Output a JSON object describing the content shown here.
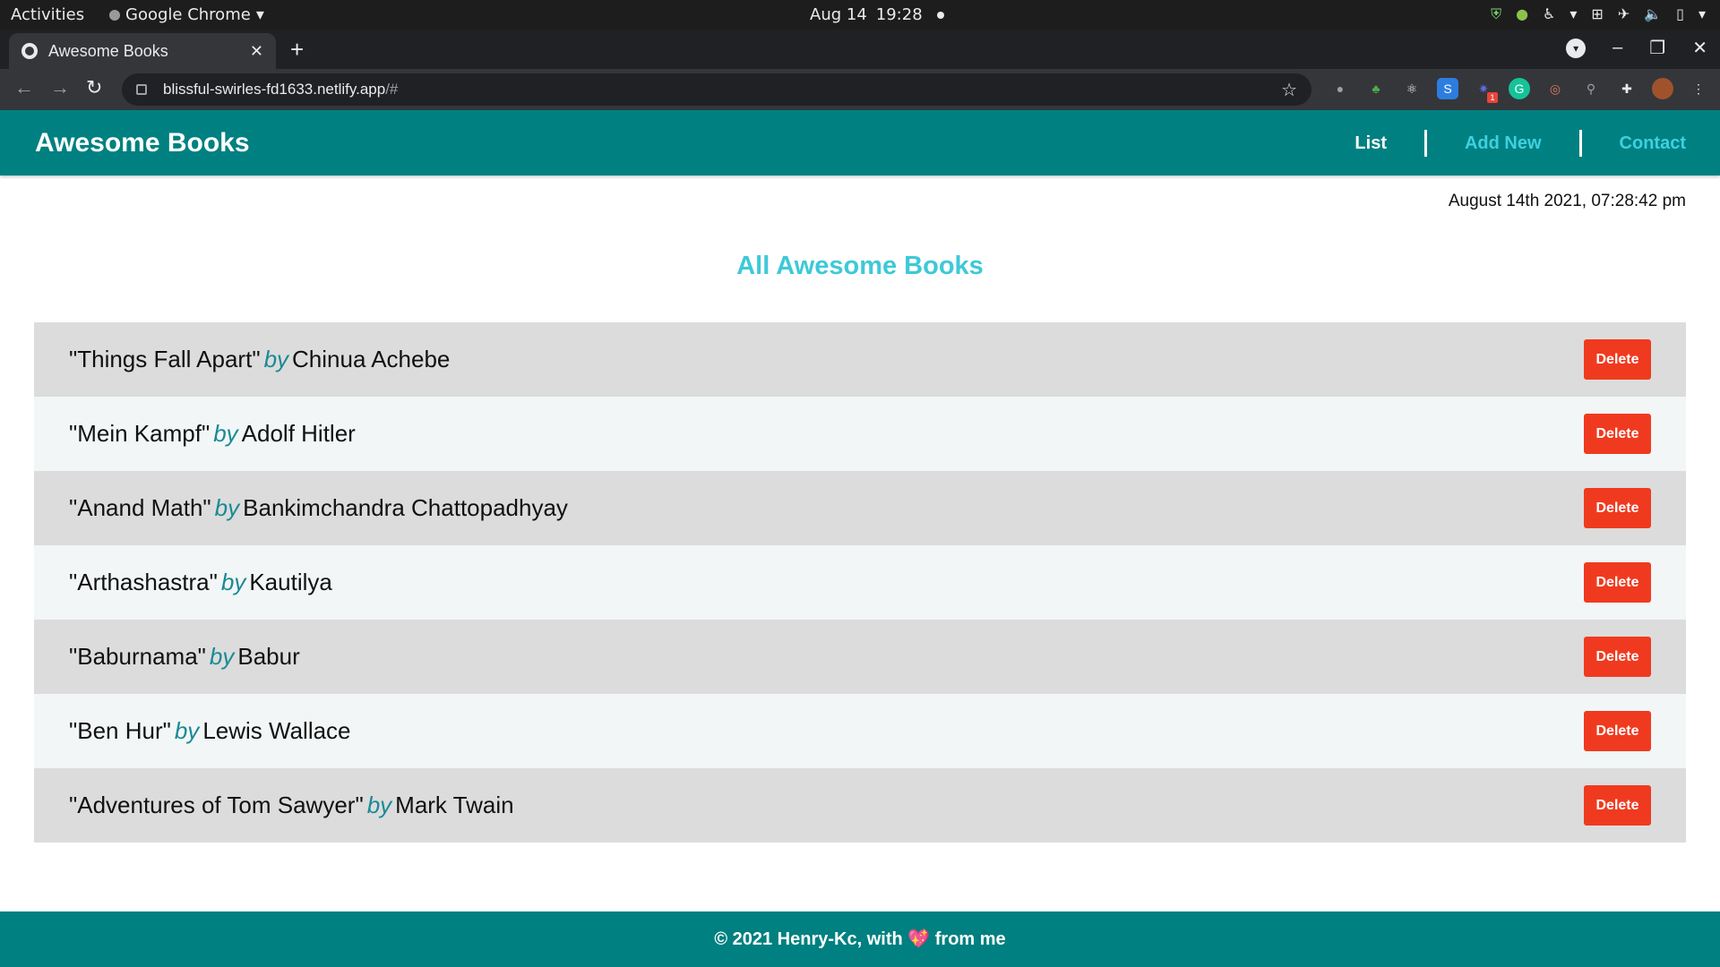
{
  "system_bar": {
    "activities": "Activities",
    "app_name": "Google Chrome",
    "date": "Aug 14",
    "time": "19:28"
  },
  "browser": {
    "tab_title": "Awesome Books",
    "url_host": "blissful-swirles-fd1633.netlify.app",
    "url_path": "/#"
  },
  "header": {
    "brand": "Awesome Books",
    "nav": {
      "list": "List",
      "add_new": "Add New",
      "contact": "Contact"
    }
  },
  "datetime": "August 14th 2021, 07:28:42 pm",
  "page_title": "All Awesome Books",
  "by_label": "by",
  "delete_label": "Delete",
  "books": [
    {
      "title": "\"Things Fall Apart\"",
      "author": "Chinua Achebe"
    },
    {
      "title": "\"Mein Kampf\"",
      "author": "Adolf Hitler"
    },
    {
      "title": "\"Anand Math\"",
      "author": "Bankimchandra Chattopadhyay"
    },
    {
      "title": "\"Arthashastra\"",
      "author": "Kautilya"
    },
    {
      "title": "\"Baburnama\"",
      "author": "Babur"
    },
    {
      "title": "\"Ben Hur\"",
      "author": "Lewis Wallace"
    },
    {
      "title": "\"Adventures of Tom Sawyer\"",
      "author": "Mark Twain"
    }
  ],
  "footer": {
    "prefix": "© 2021 Henry-Kc, with",
    "suffix": "from me"
  },
  "colors": {
    "header_bg": "#008080",
    "title_accent": "#3ec9d8",
    "delete_bg": "#f03a1f"
  }
}
